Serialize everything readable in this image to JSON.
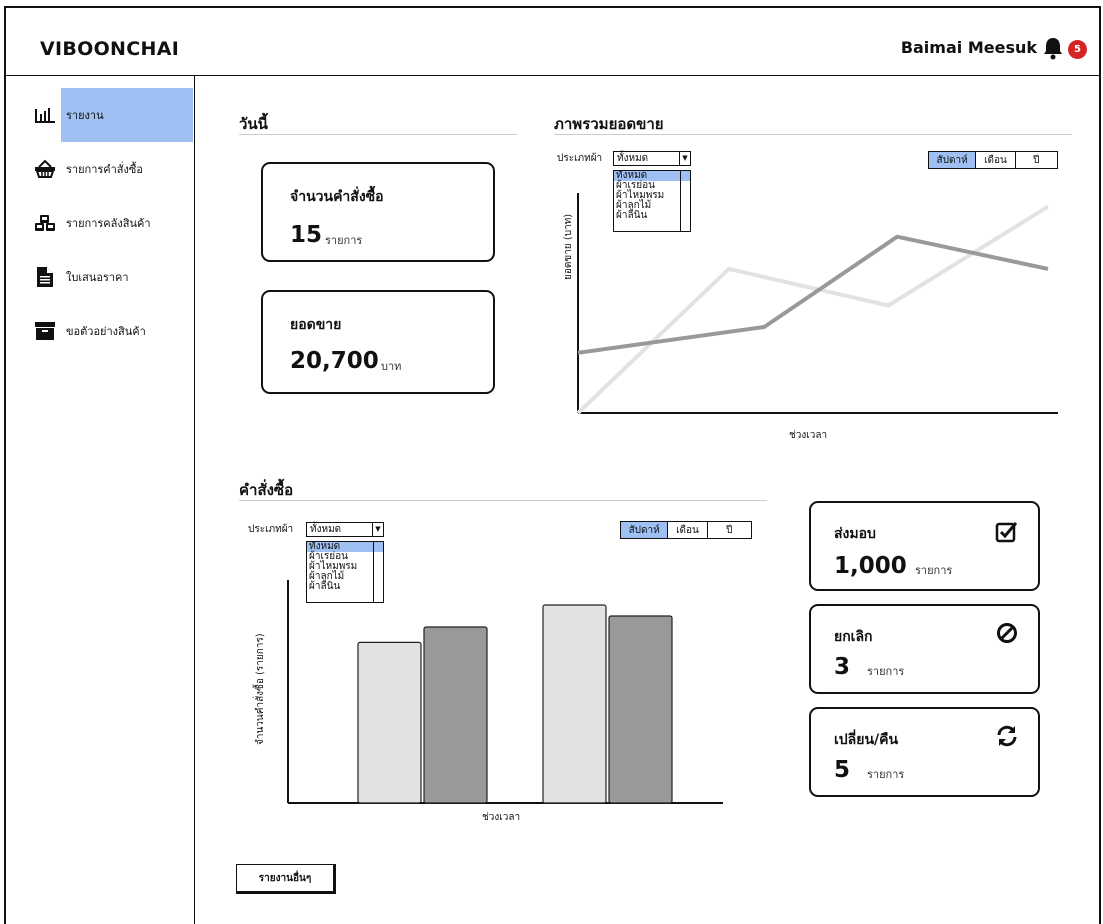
{
  "header": {
    "brand": "VIBOONCHAI",
    "user_name": "Baimai Meesuk",
    "notification_count": "5"
  },
  "sidebar": {
    "items": [
      {
        "label": "รายงาน",
        "icon": "bar-chart-icon"
      },
      {
        "label": "รายการคำสั่งซื้อ",
        "icon": "basket-icon"
      },
      {
        "label": "รายการคลังสินค้า",
        "icon": "cubes-icon"
      },
      {
        "label": "ใบเสนอราคา",
        "icon": "document-icon"
      },
      {
        "label": "ขอตัวอย่างสินค้า",
        "icon": "archive-box-icon"
      }
    ]
  },
  "today": {
    "title": "วันนี้",
    "orders_card": {
      "title": "จำนวนคำสั่งซื้อ",
      "value": "15",
      "unit": "รายการ"
    },
    "sales_card": {
      "title": "ยอดขาย",
      "value": "20,700",
      "unit": "บาท"
    }
  },
  "sales_overview": {
    "title": "ภาพรวมยอดขาย",
    "filter_label": "ประเภทผ้า",
    "filter_value": "ทั้งหมด",
    "options": [
      "ทั้งหมด",
      "ผ้าเรย่อน",
      "ผ้าไหมพรม",
      "ผ้าลูกไม้",
      "ผ้าลินิน"
    ],
    "periods": [
      "สัปดาห์",
      "เดือน",
      "ปี"
    ],
    "active_period": "สัปดาห์",
    "xlabel": "ช่วงเวลา",
    "ylabel": "ยอดขาย (บาท)"
  },
  "orders_section": {
    "title": "คำสั่งซื้อ",
    "filter_label": "ประเภทผ้า",
    "filter_value": "ทั้งหมด",
    "options": [
      "ทั้งหมด",
      "ผ้าเรย่อน",
      "ผ้าไหมพรม",
      "ผ้าลูกไม้",
      "ผ้าลินิน"
    ],
    "periods": [
      "สัปดาห์",
      "เดือน",
      "ปี"
    ],
    "active_period": "สัปดาห์",
    "xlabel": "ช่วงเวลา",
    "ylabel": "จำนวนคำสั่งซื้อ (รายการ)"
  },
  "status_cards": [
    {
      "title": "ส่งมอบ",
      "value": "1,000",
      "unit": "รายการ",
      "icon": "checkbox-icon"
    },
    {
      "title": "ยกเลิก",
      "value": "3",
      "unit": "รายการ",
      "icon": "cancel-icon"
    },
    {
      "title": "เปลี่ยน/คืน",
      "value": "5",
      "unit": "รายการ",
      "icon": "refresh-icon"
    }
  ],
  "other_reports_button": "รายงานอื่นๆ",
  "colors": {
    "accent": "#9ec0f2",
    "badge": "#d42525",
    "series_light": "#e2e2e2",
    "series_dark": "#999999"
  },
  "chart_data": [
    {
      "type": "line",
      "title": "",
      "xlabel": "ช่วงเวลา",
      "ylabel": "ยอดขาย (บาท)",
      "x": [
        1,
        2,
        3,
        4,
        5,
        6
      ],
      "ylim": [
        0,
        100
      ],
      "series": [
        {
          "values": [
            0,
            67,
            50,
            96
          ],
          "x": [
            1,
            2.7,
            4.5,
            6.3
          ]
        },
        {
          "values": [
            28,
            40,
            82,
            67
          ],
          "x": [
            1,
            3.1,
            4.6,
            6.3
          ]
        }
      ]
    },
    {
      "type": "bar",
      "title": "",
      "xlabel": "ช่วงเวลา",
      "ylabel": "จำนวนคำสั่งซื้อ (รายการ)",
      "categories": [
        "",
        ""
      ],
      "ylim": [
        0,
        100
      ],
      "series": [
        {
          "values": [
            73,
            90
          ]
        },
        {
          "values": [
            80,
            85
          ]
        }
      ]
    }
  ]
}
